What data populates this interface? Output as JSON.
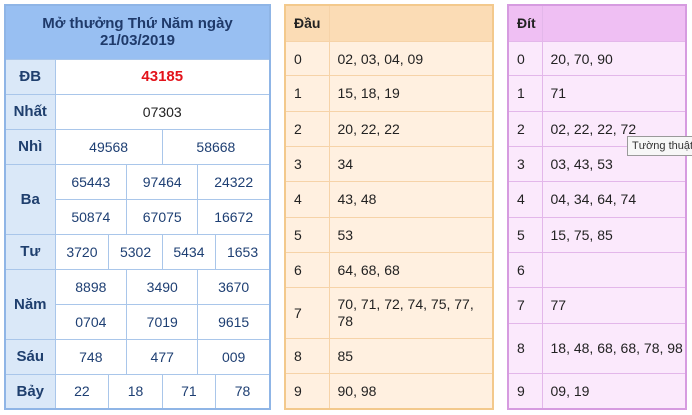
{
  "results": {
    "title_line1": "Mở thưởng Thứ Năm ngày",
    "title_line2": "21/03/2019",
    "rows": {
      "db": {
        "label": "ĐB",
        "values": [
          "43185"
        ]
      },
      "nhat": {
        "label": "Nhất",
        "values": [
          "07303"
        ]
      },
      "nhi": {
        "label": "Nhì",
        "values": [
          "49568",
          "58668"
        ]
      },
      "ba": {
        "label": "Ba",
        "values": [
          "65443",
          "97464",
          "24322",
          "50874",
          "67075",
          "16672"
        ]
      },
      "tu": {
        "label": "Tư",
        "values": [
          "3720",
          "5302",
          "5434",
          "1653"
        ]
      },
      "nam": {
        "label": "Năm",
        "values": [
          "8898",
          "3490",
          "3670",
          "0704",
          "7019",
          "9615"
        ]
      },
      "sau": {
        "label": "Sáu",
        "values": [
          "748",
          "477",
          "009"
        ]
      },
      "bay": {
        "label": "Bảy",
        "values": [
          "22",
          "18",
          "71",
          "78"
        ]
      }
    }
  },
  "dau": {
    "header": "Đầu",
    "rows": [
      {
        "digit": "0",
        "values": "02, 03, 04, 09"
      },
      {
        "digit": "1",
        "values": "15, 18, 19"
      },
      {
        "digit": "2",
        "values": "20, 22, 22"
      },
      {
        "digit": "3",
        "values": "34"
      },
      {
        "digit": "4",
        "values": "43, 48"
      },
      {
        "digit": "5",
        "values": "53"
      },
      {
        "digit": "6",
        "values": "64, 68, 68"
      },
      {
        "digit": "7",
        "values": "70, 71, 72, 74, 75, 77, 78"
      },
      {
        "digit": "8",
        "values": "85"
      },
      {
        "digit": "9",
        "values": "90, 98"
      }
    ]
  },
  "dit": {
    "header": "Đít",
    "rows": [
      {
        "digit": "0",
        "values": "20, 70, 90"
      },
      {
        "digit": "1",
        "values": "71"
      },
      {
        "digit": "2",
        "values": "02, 22, 22, 72"
      },
      {
        "digit": "3",
        "values": "03, 43, 53"
      },
      {
        "digit": "4",
        "values": "04, 34, 64, 74"
      },
      {
        "digit": "5",
        "values": "15, 75, 85"
      },
      {
        "digit": "6",
        "values": ""
      },
      {
        "digit": "7",
        "values": "77"
      },
      {
        "digit": "8",
        "values": "18, 48, 68, 68, 78, 98"
      },
      {
        "digit": "9",
        "values": "09, 19"
      }
    ]
  },
  "tooltip": {
    "text": "Tường thuật"
  },
  "colors": {
    "special_prize": "#e3131b",
    "results_header": "#98bff2",
    "dau_header": "#fbdcb5",
    "dit_header": "#efbff3"
  }
}
